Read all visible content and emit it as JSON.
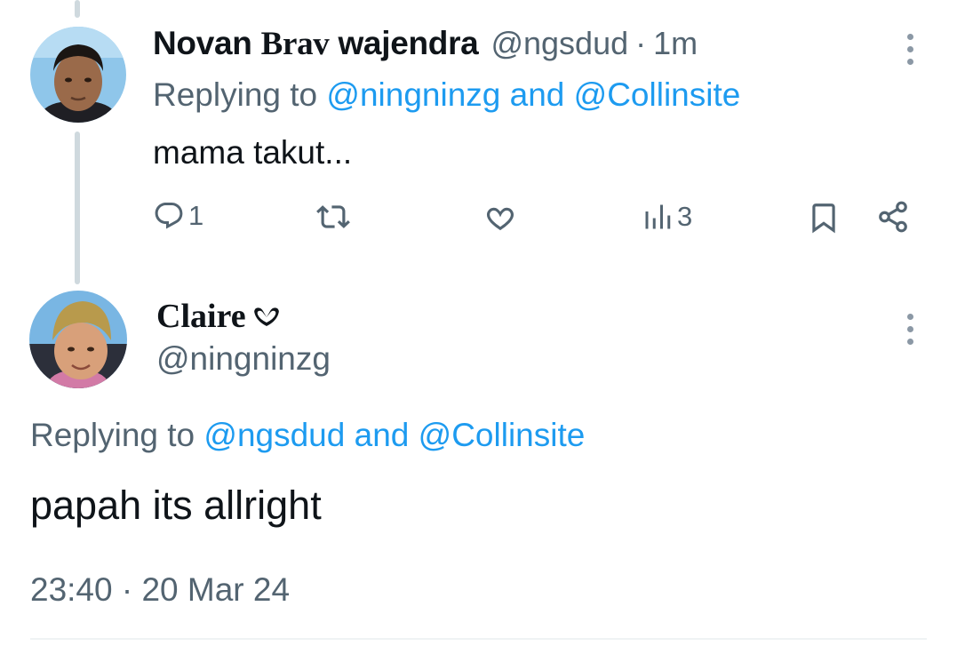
{
  "reply_tweet": {
    "author": {
      "name_part1": "Novan",
      "name_part2": "Brav",
      "name_part3": "wajendra",
      "handle": "@ngsdud",
      "separator": "·",
      "time": "1m"
    },
    "replying_prefix": "Replying to",
    "mention_1": "@ningninzg",
    "conjunction": "and",
    "mention_2": "@Collinsite",
    "text": "mama takut...",
    "actions": {
      "reply_count": "1",
      "views_count": "3"
    },
    "icons": [
      "reply-icon",
      "retweet-icon",
      "like-icon",
      "views-icon",
      "bookmark-icon",
      "share-icon",
      "more-icon"
    ]
  },
  "main_tweet": {
    "author": {
      "name": "Claire",
      "badge_icon": "heart-badge-icon",
      "handle": "@ningninzg"
    },
    "replying_prefix": "Replying to",
    "mention_1": "@ngsdud",
    "conjunction": "and",
    "mention_2": "@Collinsite",
    "text": "papah its allright",
    "timestamp": "23:40 · 20 Mar 24"
  },
  "colors": {
    "link": "#1d9bf0",
    "secondary_text": "#536471",
    "thread_line": "#cfd9de"
  }
}
